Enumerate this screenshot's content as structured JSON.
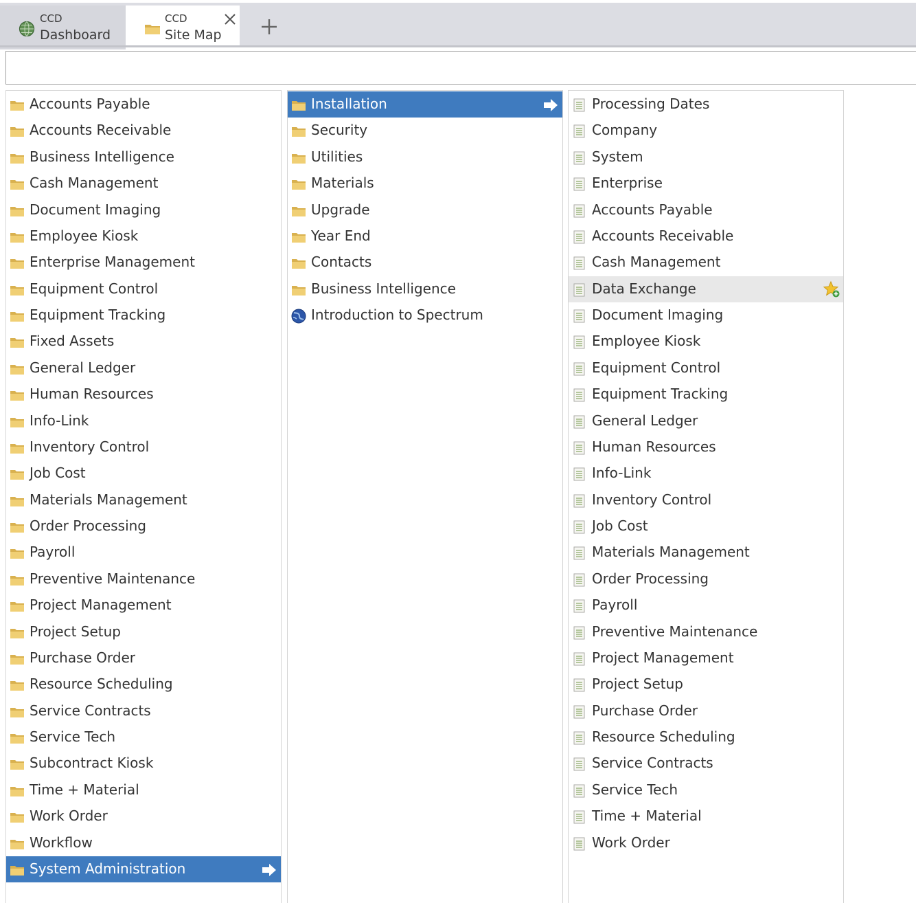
{
  "tabs": [
    {
      "line1": "CCD",
      "line2": "Dashboard",
      "icon": "globe-icon",
      "active": false
    },
    {
      "line1": "CCD",
      "line2": "Site Map",
      "icon": "folder-icon",
      "active": true
    }
  ],
  "search": {
    "value": "",
    "placeholder": ""
  },
  "colors": {
    "selected": "#3f7bbf",
    "hover": "#e8e8e8",
    "folder": "#e7c466",
    "tab_bar": "#dcdde3"
  },
  "column1": {
    "items": [
      "Accounts Payable",
      "Accounts Receivable",
      "Business Intelligence",
      "Cash Management",
      "Document Imaging",
      "Employee Kiosk",
      "Enterprise Management",
      "Equipment Control",
      "Equipment Tracking",
      "Fixed Assets",
      "General Ledger",
      "Human Resources",
      "Info-Link",
      "Inventory Control",
      "Job Cost",
      "Materials Management",
      "Order Processing",
      "Payroll",
      "Preventive Maintenance",
      "Project Management",
      "Project Setup",
      "Purchase Order",
      "Resource Scheduling",
      "Service Contracts",
      "Service Tech",
      "Subcontract Kiosk",
      "Time + Material",
      "Work Order",
      "Workflow",
      "System Administration"
    ],
    "selected": "System Administration",
    "icon": "folder-icon"
  },
  "column2": {
    "items": [
      {
        "label": "Installation",
        "icon": "folder-icon"
      },
      {
        "label": "Security",
        "icon": "folder-icon"
      },
      {
        "label": "Utilities",
        "icon": "folder-icon"
      },
      {
        "label": "Materials",
        "icon": "folder-icon"
      },
      {
        "label": "Upgrade",
        "icon": "folder-icon"
      },
      {
        "label": "Year End",
        "icon": "folder-icon"
      },
      {
        "label": "Contacts",
        "icon": "folder-icon"
      },
      {
        "label": "Business Intelligence",
        "icon": "folder-icon"
      },
      {
        "label": "Introduction to Spectrum",
        "icon": "globe-icon"
      }
    ],
    "selected": "Installation"
  },
  "column3": {
    "items": [
      "Processing Dates",
      "Company",
      "System",
      "Enterprise",
      "Accounts Payable",
      "Accounts Receivable",
      "Cash Management",
      "Data Exchange",
      "Document Imaging",
      "Employee Kiosk",
      "Equipment Control",
      "Equipment Tracking",
      "General Ledger",
      "Human Resources",
      "Info-Link",
      "Inventory Control",
      "Job Cost",
      "Materials Management",
      "Order Processing",
      "Payroll",
      "Preventive Maintenance",
      "Project Management",
      "Project Setup",
      "Purchase Order",
      "Resource Scheduling",
      "Service Contracts",
      "Service Tech",
      "Time + Material",
      "Work Order"
    ],
    "hovered": "Data Exchange",
    "icon": "document-icon"
  }
}
